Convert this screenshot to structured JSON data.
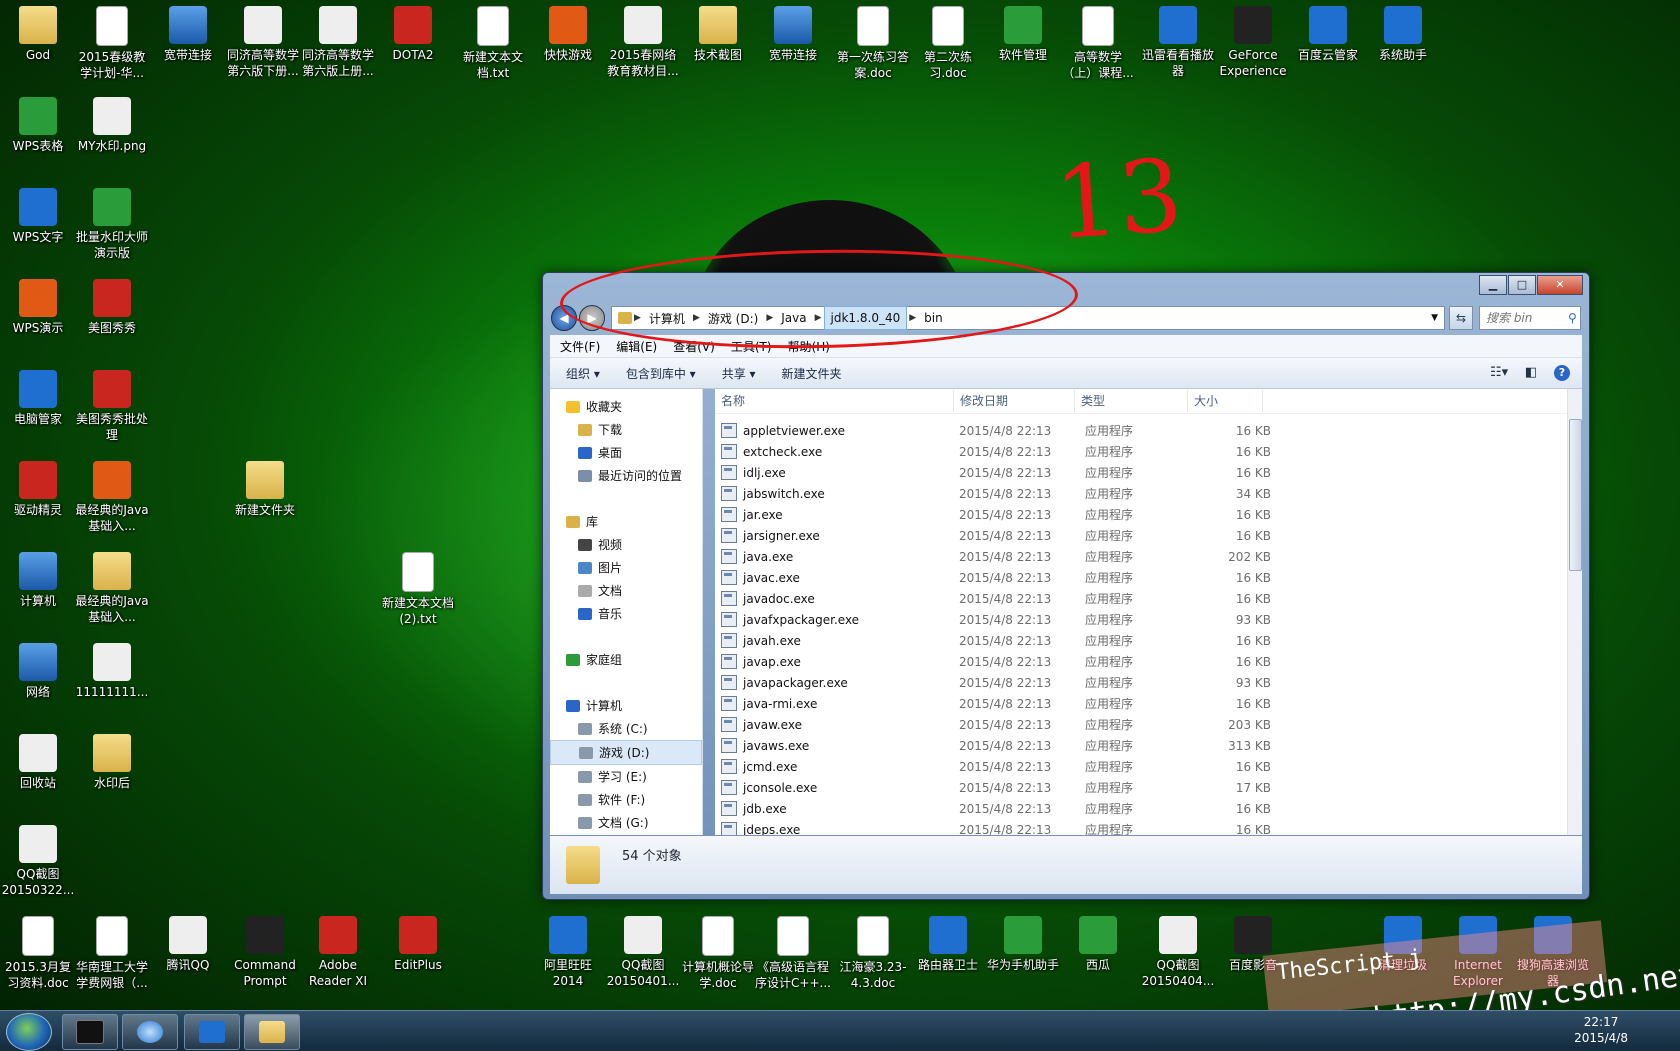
{
  "desktop_icons": [
    {
      "label": "God",
      "kind": "folder"
    },
    {
      "label": "2015春级教学计划-华...",
      "kind": "doc"
    },
    {
      "label": "宽带连接",
      "kind": "pc"
    },
    {
      "label": "同济高等数学第六版下册...",
      "kind": "book"
    },
    {
      "label": "同济高等数学第六版上册...",
      "kind": "book"
    },
    {
      "label": "DOTA2",
      "kind": "red"
    },
    {
      "label": "新建文本文档.txt",
      "kind": "txt"
    },
    {
      "label": "快快游戏",
      "kind": "orange"
    },
    {
      "label": "2015春网络教育教材目...",
      "kind": "xls"
    },
    {
      "label": "技术截图",
      "kind": "folder"
    },
    {
      "label": "宽带连接",
      "kind": "pc"
    },
    {
      "label": "第一次练习答案.doc",
      "kind": "doc"
    },
    {
      "label": "第二次练习.doc",
      "kind": "doc"
    },
    {
      "label": "软件管理",
      "kind": "green"
    },
    {
      "label": "高等数学（上）课程...",
      "kind": "doc"
    },
    {
      "label": "迅雷看看播放器",
      "kind": "blue"
    },
    {
      "label": "GeForce Experience",
      "kind": "dark"
    },
    {
      "label": "百度云管家",
      "kind": "blue"
    },
    {
      "label": "系统助手",
      "kind": "blue"
    },
    {
      "label": "WPS表格",
      "kind": "green"
    },
    {
      "label": "MY水印.png",
      "kind": "png"
    },
    {
      "label": "WPS文字",
      "kind": "blue"
    },
    {
      "label": "批量水印大师演示版",
      "kind": "green"
    },
    {
      "label": "WPS演示",
      "kind": "orange"
    },
    {
      "label": "美图秀秀",
      "kind": "red"
    },
    {
      "label": "电脑管家",
      "kind": "blue"
    },
    {
      "label": "美图秀秀批处理",
      "kind": "red"
    },
    {
      "label": "驱动精灵",
      "kind": "red"
    },
    {
      "label": "最经典的Java基础入...",
      "kind": "orange"
    },
    {
      "label": "新建文件夹",
      "kind": "folder"
    },
    {
      "label": "计算机",
      "kind": "pc"
    },
    {
      "label": "最经典的Java基础入...",
      "kind": "folder"
    },
    {
      "label": "新建文本文档(2).txt",
      "kind": "txt"
    },
    {
      "label": "网络",
      "kind": "pc"
    },
    {
      "label": "11111111...",
      "kind": "png"
    },
    {
      "label": "回收站",
      "kind": "white"
    },
    {
      "label": "水印后",
      "kind": "folder"
    },
    {
      "label": "QQ截图20150322...",
      "kind": "png"
    },
    {
      "label": "2015.3月复习资料.doc",
      "kind": "doc"
    },
    {
      "label": "华南理工大学学费网银（...",
      "kind": "doc"
    },
    {
      "label": "腾讯QQ",
      "kind": "white"
    },
    {
      "label": "Command Prompt",
      "kind": "dark"
    },
    {
      "label": "Adobe Reader XI",
      "kind": "red"
    },
    {
      "label": "EditPlus",
      "kind": "red"
    },
    {
      "label": "阿里旺旺2014",
      "kind": "blue"
    },
    {
      "label": "QQ截图20150401...",
      "kind": "png"
    },
    {
      "label": "计算机概论导学.doc",
      "kind": "doc"
    },
    {
      "label": "《高级语言程序设计C++...",
      "kind": "doc"
    },
    {
      "label": "江海豪3.23-4.3.doc",
      "kind": "doc"
    },
    {
      "label": "路由器卫士",
      "kind": "blue"
    },
    {
      "label": "华为手机助手",
      "kind": "green"
    },
    {
      "label": "西瓜",
      "kind": "green"
    },
    {
      "label": "QQ截图20150404...",
      "kind": "png"
    },
    {
      "label": "百度影音",
      "kind": "dark"
    },
    {
      "label": "清理垃圾",
      "kind": "blue"
    },
    {
      "label": "Internet Explorer",
      "kind": "blue"
    },
    {
      "label": "搜狗高速浏览器",
      "kind": "blue"
    }
  ],
  "window": {
    "breadcrumbs": [
      "计算机",
      "游戏 (D:)",
      "Java",
      "jdk1.8.0_40",
      "bin"
    ],
    "search_placeholder": "搜索 bin",
    "menu": [
      "文件(F)",
      "编辑(E)",
      "查看(V)",
      "工具(T)",
      "帮助(H)"
    ],
    "toolbar": [
      "组织 ▾",
      "包含到库中 ▾",
      "共享 ▾",
      "新建文件夹"
    ],
    "nav": [
      {
        "label": "收藏夹",
        "level": 0,
        "color": "#f2c12e"
      },
      {
        "label": "下载",
        "level": 1,
        "color": "#d9b24a"
      },
      {
        "label": "桌面",
        "level": 1,
        "color": "#2a66c8"
      },
      {
        "label": "最近访问的位置",
        "level": 1,
        "color": "#7a8fa8"
      },
      {
        "label": "",
        "level": 0,
        "color": ""
      },
      {
        "label": "库",
        "level": 0,
        "color": "#d9b24a"
      },
      {
        "label": "视频",
        "level": 1,
        "color": "#444"
      },
      {
        "label": "图片",
        "level": 1,
        "color": "#4a88c8"
      },
      {
        "label": "文档",
        "level": 1,
        "color": "#aaa"
      },
      {
        "label": "音乐",
        "level": 1,
        "color": "#2a66c8"
      },
      {
        "label": "",
        "level": 0,
        "color": ""
      },
      {
        "label": "家庭组",
        "level": 0,
        "color": "#2a9d3a"
      },
      {
        "label": "",
        "level": 0,
        "color": ""
      },
      {
        "label": "计算机",
        "level": 0,
        "color": "#2a66c8"
      },
      {
        "label": "系统 (C:)",
        "level": 1,
        "color": "#8899aa"
      },
      {
        "label": "游戏 (D:)",
        "level": 1,
        "color": "#8899aa",
        "selected": true
      },
      {
        "label": "学习 (E:)",
        "level": 1,
        "color": "#8899aa"
      },
      {
        "label": "软件 (F:)",
        "level": 1,
        "color": "#8899aa"
      },
      {
        "label": "文档 (G:)",
        "level": 1,
        "color": "#8899aa"
      }
    ],
    "columns": [
      "名称",
      "修改日期",
      "类型",
      "大小"
    ],
    "files": [
      [
        "appletviewer.exe",
        "2015/4/8 22:13",
        "应用程序",
        "16 KB"
      ],
      [
        "extcheck.exe",
        "2015/4/8 22:13",
        "应用程序",
        "16 KB"
      ],
      [
        "idlj.exe",
        "2015/4/8 22:13",
        "应用程序",
        "16 KB"
      ],
      [
        "jabswitch.exe",
        "2015/4/8 22:13",
        "应用程序",
        "34 KB"
      ],
      [
        "jar.exe",
        "2015/4/8 22:13",
        "应用程序",
        "16 KB"
      ],
      [
        "jarsigner.exe",
        "2015/4/8 22:13",
        "应用程序",
        "16 KB"
      ],
      [
        "java.exe",
        "2015/4/8 22:13",
        "应用程序",
        "202 KB"
      ],
      [
        "javac.exe",
        "2015/4/8 22:13",
        "应用程序",
        "16 KB"
      ],
      [
        "javadoc.exe",
        "2015/4/8 22:13",
        "应用程序",
        "16 KB"
      ],
      [
        "javafxpackager.exe",
        "2015/4/8 22:13",
        "应用程序",
        "93 KB"
      ],
      [
        "javah.exe",
        "2015/4/8 22:13",
        "应用程序",
        "16 KB"
      ],
      [
        "javap.exe",
        "2015/4/8 22:13",
        "应用程序",
        "16 KB"
      ],
      [
        "javapackager.exe",
        "2015/4/8 22:13",
        "应用程序",
        "93 KB"
      ],
      [
        "java-rmi.exe",
        "2015/4/8 22:13",
        "应用程序",
        "16 KB"
      ],
      [
        "javaw.exe",
        "2015/4/8 22:13",
        "应用程序",
        "203 KB"
      ],
      [
        "javaws.exe",
        "2015/4/8 22:13",
        "应用程序",
        "313 KB"
      ],
      [
        "jcmd.exe",
        "2015/4/8 22:13",
        "应用程序",
        "16 KB"
      ],
      [
        "jconsole.exe",
        "2015/4/8 22:13",
        "应用程序",
        "17 KB"
      ],
      [
        "jdb.exe",
        "2015/4/8 22:13",
        "应用程序",
        "16 KB"
      ],
      [
        "jdeps.exe",
        "2015/4/8 22:13",
        "应用程序",
        "16 KB"
      ]
    ],
    "status": "54 个对象"
  },
  "annotation_text": "13",
  "watermark": {
    "line1": "TheScript j",
    "line2": "http://my.csdn.net/"
  },
  "clock": {
    "time": "22:17",
    "date": "2015/4/8"
  }
}
